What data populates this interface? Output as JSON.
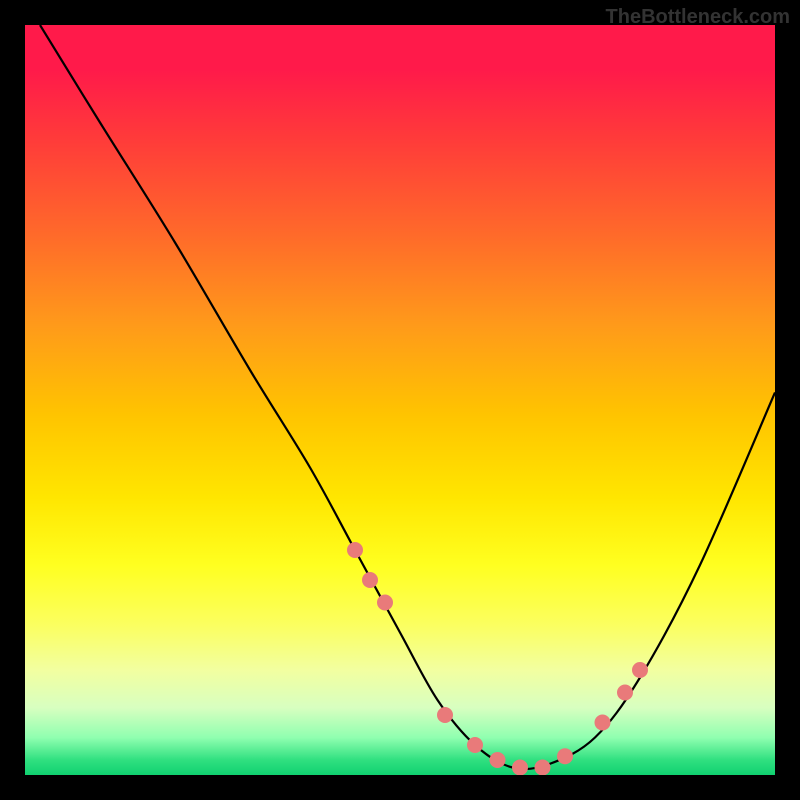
{
  "watermark": "TheBottleneck.com",
  "chart_data": {
    "type": "line",
    "title": "",
    "xlabel": "",
    "ylabel": "",
    "xlim": [
      0,
      100
    ],
    "ylim": [
      0,
      100
    ],
    "curve": {
      "x": [
        2,
        10,
        20,
        30,
        38,
        44,
        50,
        55,
        60,
        65,
        70,
        76,
        82,
        90,
        100
      ],
      "y": [
        100,
        87,
        71,
        54,
        41,
        30,
        19,
        10,
        4,
        1,
        1.5,
        5,
        13,
        28,
        51
      ]
    },
    "dots": {
      "x": [
        44,
        46,
        48,
        56,
        60,
        63,
        66,
        69,
        72,
        77,
        80,
        82
      ],
      "y": [
        30,
        26,
        23,
        8,
        4,
        2,
        1,
        1,
        2.5,
        7,
        11,
        14
      ]
    },
    "dot_color": "#e97a7a",
    "dot_radius_px": 8,
    "line_color": "#000000"
  }
}
